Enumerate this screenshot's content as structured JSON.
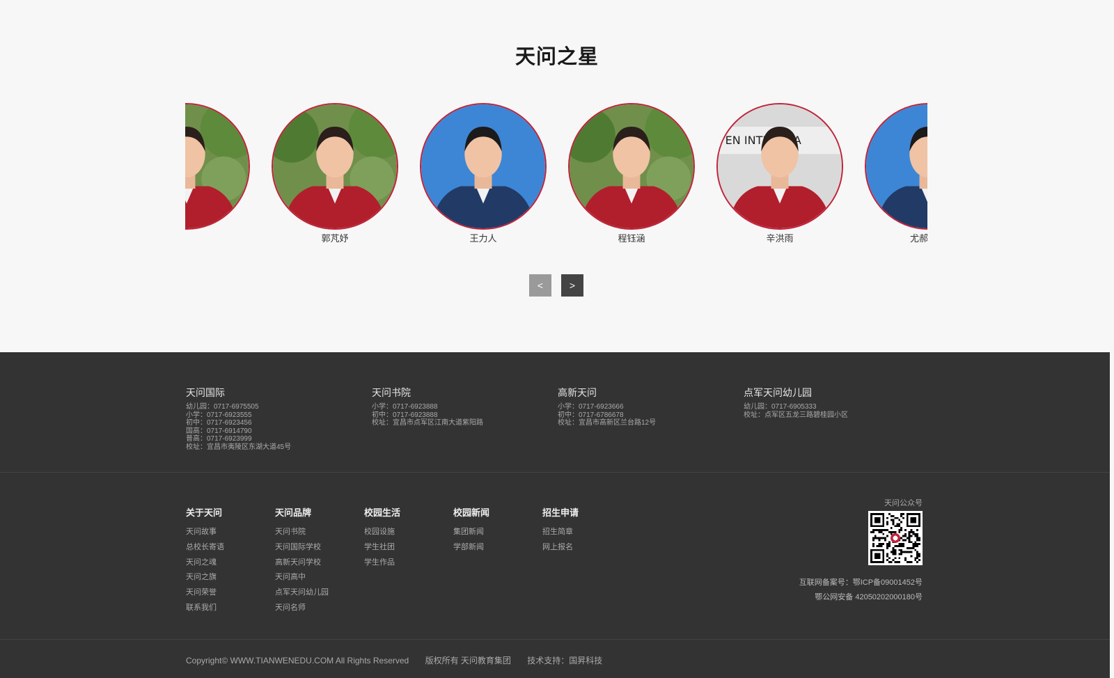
{
  "stars_section": {
    "title": "天问之星",
    "students": [
      {
        "name": "",
        "background": "garden"
      },
      {
        "name": "郭芃妤",
        "background": "garden"
      },
      {
        "name": "王力人",
        "background": "blue"
      },
      {
        "name": "程钰涵",
        "background": "garden"
      },
      {
        "name": "辛洪雨",
        "background": "sign"
      },
      {
        "name": "尤郝龙辉",
        "background": "blue"
      }
    ],
    "prev_label": "<",
    "next_label": ">"
  },
  "contacts": [
    {
      "title": "天问国际",
      "lines": [
        "幼儿园：0717-6975505",
        "小学：0717-6923555",
        "初中：0717-6923456",
        "国高：0717-6914790",
        "普高：0717-6923999",
        "校址：宜昌市夷陵区东湖大道45号"
      ]
    },
    {
      "title": "天问书院",
      "lines": [
        "小学：0717-6923888",
        "初中：0717-6923888",
        "校址：宜昌市点军区江南大道紫阳路"
      ]
    },
    {
      "title": "高新天问",
      "lines": [
        "小学：0717-6923666",
        "初中：0717-6786678",
        "校址：宜昌市高新区兰台路12号"
      ]
    },
    {
      "title": "点军天问幼儿园",
      "lines": [
        "幼儿园：0717-6905333",
        "校址：点军区五龙三路碧桂园小区"
      ]
    }
  ],
  "nav": [
    {
      "title": "关于天问",
      "links": [
        "天问故事",
        "总校长寄语",
        "天问之魂",
        "天问之旗",
        "天问荣誉",
        "联系我们"
      ]
    },
    {
      "title": "天问品牌",
      "links": [
        "天问书院",
        "天问国际学校",
        "高新天问学校",
        "天问高中",
        "点军天问幼儿园",
        "天问名师"
      ]
    },
    {
      "title": "校园生活",
      "links": [
        "校园设施",
        "学生社团",
        "学生作品"
      ]
    },
    {
      "title": "校园新闻",
      "links": [
        "集团新闻",
        "学部新闻"
      ]
    },
    {
      "title": "招生申请",
      "links": [
        "招生简章",
        "网上报名"
      ]
    }
  ],
  "qr": {
    "label": "天问公众号",
    "icp": "互联网备案号：鄂ICP备09001452号",
    "police": "鄂公网安备 42050202000180号"
  },
  "copyright": {
    "text": "Copyright© WWW.TIANWENEDU.COM All Rights Reserved",
    "owner": "版权所有 天问教育集团",
    "support": "技术支持：国昇科技"
  },
  "colors": {
    "accent_red": "#c0223a",
    "footer_bg": "#333333",
    "page_bg": "#f7f7f7",
    "photo_blue": "#3d86d6"
  }
}
